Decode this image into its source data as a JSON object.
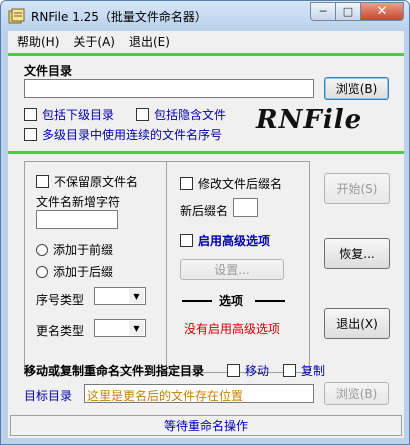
{
  "window": {
    "title": "RNFile 1.25（批量文件命名器）"
  },
  "menu": {
    "items": [
      "帮助(H)",
      "关于(A)",
      "退出(E)"
    ]
  },
  "source": {
    "label": "文件目录",
    "path_value": "",
    "browse_button": "浏览(B)",
    "include_subdirs": "包括下级目录",
    "include_hidden": "包括隐含文件",
    "continuous_numbering": "多级目录中使用连续的文件名序号",
    "logo_text": "RNFile"
  },
  "options": {
    "keep_original": "不保留原文件名",
    "new_chars_label": "文件名新增字符",
    "new_chars_value": "",
    "add_prefix": "添加于前缀",
    "add_suffix": "添加于后缀",
    "seq_type_label": "序号类型",
    "rename_type_label": "更名类型"
  },
  "extension": {
    "modify_ext": "修改文件后缀名",
    "new_ext_label": "新后缀名",
    "new_ext_value": ""
  },
  "advanced": {
    "enable_label": "启用高级选项",
    "settings_button": "设置...",
    "section_title": "选项",
    "status_text": "没有启用高级选项"
  },
  "actions": {
    "start_button": "开始(S)",
    "restore_button": "恢复...",
    "exit_button": "退出(X)"
  },
  "target": {
    "heading": "移动或复制重命名文件到指定目录",
    "move_label": "移动",
    "copy_label": "复制",
    "dir_label": "目标目录",
    "dir_value": "这里是更名后的文件存在位置",
    "browse_button": "浏览(B)"
  },
  "status": {
    "text": "等待重命名操作"
  },
  "colors": {
    "accent_green": "#4ec94a",
    "label_blue": "#0000b0",
    "warning_red": "#d40000",
    "target_text": "#c88000"
  }
}
